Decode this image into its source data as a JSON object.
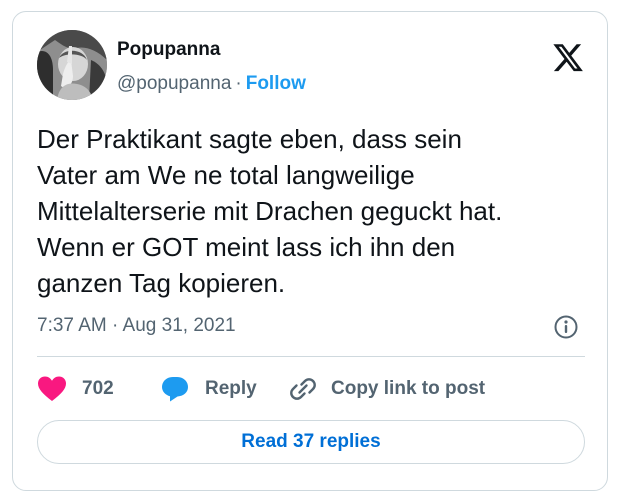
{
  "user": {
    "name": "Popupanna",
    "handle": "@popupanna",
    "separator": "·",
    "follow_label": "Follow"
  },
  "tweet": {
    "lines": [
      "Der Praktikant sagte eben, dass sein",
      "Vater am We ne total langweilige",
      "Mittelalterserie mit Drachen geguckt hat.",
      "Wenn er GOT meint lass ich ihn den",
      "ganzen Tag kopieren."
    ],
    "timestamp": "7:37 AM · Aug 31, 2021"
  },
  "actions": {
    "like_count": "702",
    "reply_label": "Reply",
    "copy_label": "Copy link to post"
  },
  "read_replies_label": "Read 37 replies",
  "icons": {
    "logo": "x-logo-icon",
    "info": "info-icon",
    "like": "heart-icon",
    "reply": "speech-bubble-icon",
    "copy": "link-icon"
  },
  "colors": {
    "text": "#0f1419",
    "muted": "#536471",
    "accent": "#1d9bf0",
    "like": "#f91880",
    "border": "#cfd9de",
    "read_link": "#006fd6"
  }
}
